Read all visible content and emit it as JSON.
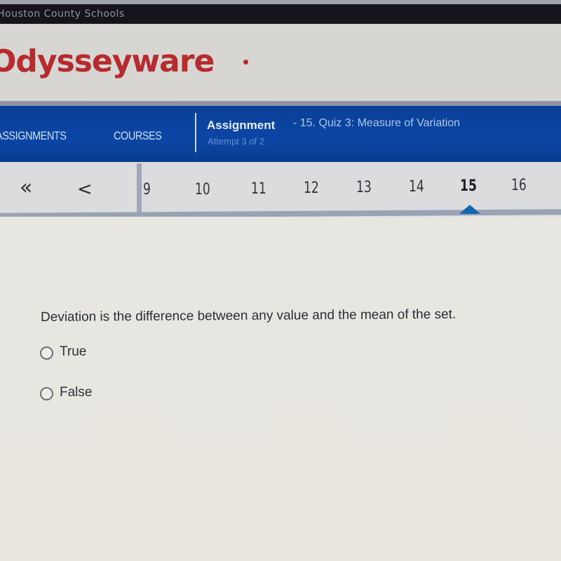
{
  "header": {
    "district": "Houston County Schools",
    "brand": "Odysseyware",
    "brand_color": "#b52b2e"
  },
  "nav": {
    "links": [
      {
        "label": "ASSIGNMENTS"
      },
      {
        "label": "COURSES"
      }
    ],
    "assignment_label": "Assignment",
    "assignment_name": "- 15. Quiz 3: Measure of Variation",
    "attempt": "Attempt 3 of 2",
    "nav_color": "#0b46a6"
  },
  "question_nav": {
    "first_icon": "double-chevron-left-icon",
    "prev_icon": "chevron-left-icon",
    "first_glyph": "«",
    "prev_glyph": "<",
    "numbers": [
      "9",
      "10",
      "11",
      "12",
      "13",
      "14",
      "15",
      "16"
    ],
    "current": "15",
    "marker_color": "#1466b0"
  },
  "question": {
    "text": "Deviation is the difference between any value and the mean of the set.",
    "options": [
      {
        "label": "True",
        "selected": false
      },
      {
        "label": "False",
        "selected": false
      }
    ]
  }
}
